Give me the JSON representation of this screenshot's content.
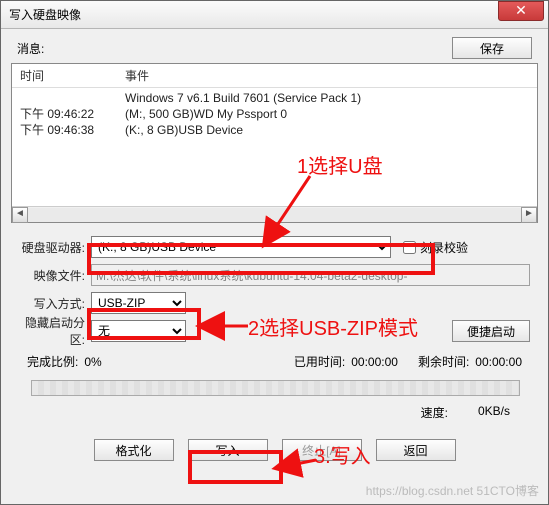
{
  "window": {
    "title": "写入硬盘映像"
  },
  "buttons": {
    "save": "保存",
    "convenient_boot": "便捷启动",
    "format": "格式化",
    "write": "写入",
    "abort": "终止[A]",
    "back": "返回"
  },
  "log": {
    "header_time": "时间",
    "header_event": "事件",
    "rows": [
      {
        "time": "",
        "event": "Windows 7 v6.1 Build 7601 (Service Pack 1)"
      },
      {
        "time": "下午 09:46:22",
        "event": "(M:, 500 GB)WD     My  Pssport   0"
      },
      {
        "time": "下午 09:46:38",
        "event": "(K:, 8 GB)USB Device"
      }
    ]
  },
  "form": {
    "drive_label": "硬盘驱动器:",
    "drive_value": "(K:, 8 GB)USB Device",
    "burn_verify": "刻录校验",
    "image_label": "映像文件:",
    "image_value": "M:\\杰达\\软件\\系统\\linux系统\\kubuntu-14.04-beta2-desktop-",
    "method_label": "写入方式:",
    "method_value": "USB-ZIP",
    "hide_label": "隐藏启动分区:",
    "hide_value": "无"
  },
  "progress": {
    "complete_label": "完成比例:",
    "complete_value": "0%",
    "elapsed_label": "已用时间:",
    "elapsed_value": "00:00:00",
    "remain_label": "剩余时间:",
    "remain_value": "00:00:00",
    "speed_label": "速度:",
    "speed_value": "0KB/s"
  },
  "annotations": {
    "a1_num": "1",
    "a1_text": "选择U盘",
    "a2_num": "2",
    "a2_text": "选择USB-ZIP模式",
    "a3_num": "3.",
    "a3_text": "写入"
  },
  "watermark": "https://blog.csdn.net 51CTO博客",
  "colors": {
    "annotation": "#e11"
  }
}
